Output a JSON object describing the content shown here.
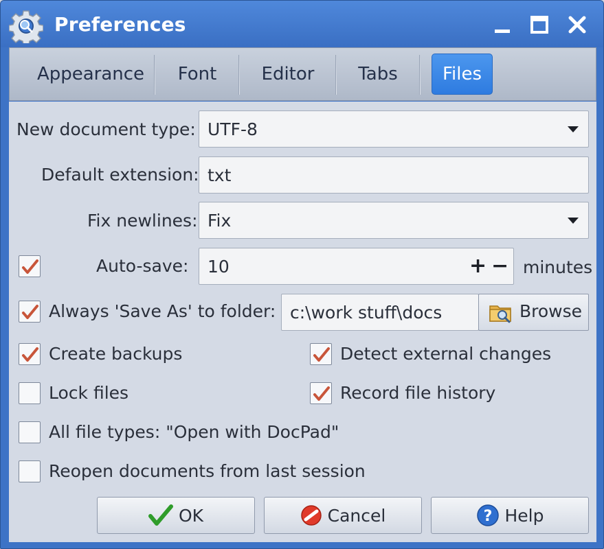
{
  "window": {
    "title": "Preferences"
  },
  "tabs": [
    {
      "label": "Appearance",
      "active": false
    },
    {
      "label": "Font",
      "active": false
    },
    {
      "label": "Editor",
      "active": false
    },
    {
      "label": "Tabs",
      "active": false
    },
    {
      "label": "Files",
      "active": true
    }
  ],
  "form": {
    "new_document_type": {
      "label": "New document type:",
      "value": "UTF-8"
    },
    "default_extension": {
      "label": "Default extension:",
      "value": "txt"
    },
    "fix_newlines": {
      "label": "Fix newlines:",
      "value": "Fix"
    },
    "auto_save": {
      "label": "Auto-save:",
      "value": "10",
      "unit": "minutes",
      "checked": true,
      "plus": "+",
      "minus": "−"
    },
    "save_as_folder": {
      "label": "Always 'Save As' to folder:",
      "value": "c:\\work stuff\\docs",
      "checked": true,
      "browse_label": "Browse"
    }
  },
  "options": {
    "create_backups": {
      "label": "Create backups",
      "checked": true
    },
    "detect_external_changes": {
      "label": "Detect external changes",
      "checked": true
    },
    "lock_files": {
      "label": "Lock files",
      "checked": false
    },
    "record_file_history": {
      "label": "Record file history",
      "checked": true
    },
    "all_file_types": {
      "label": "All file types: \"Open with DocPad\"",
      "checked": false
    },
    "reopen_documents": {
      "label": "Reopen documents from last session",
      "checked": false
    }
  },
  "buttons": {
    "ok": "OK",
    "cancel": "Cancel",
    "help": "Help"
  },
  "colors": {
    "titlebar": "#3d73c6",
    "active_tab": "#2e7be0",
    "check_mark": "#c8553a"
  },
  "icons": {
    "app": "gear-magnifier-icon",
    "browse": "folder-search-icon",
    "ok": "green-check-icon",
    "cancel": "no-entry-icon",
    "help": "question-icon"
  }
}
